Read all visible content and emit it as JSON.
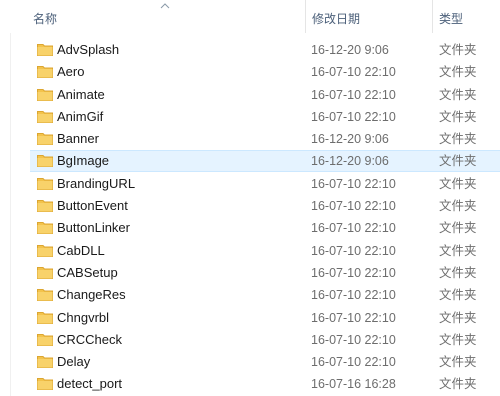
{
  "columns": {
    "name": "名称",
    "date": "修改日期",
    "type": "类型"
  },
  "accent": {
    "folder": "#f3c34c",
    "folder_dark": "#dca631",
    "selection": "#e5f3ff"
  },
  "files": [
    {
      "name": "AdvSplash",
      "date": "16-12-20 9:06",
      "type": "文件夹"
    },
    {
      "name": "Aero",
      "date": "16-07-10 22:10",
      "type": "文件夹"
    },
    {
      "name": "Animate",
      "date": "16-07-10 22:10",
      "type": "文件夹"
    },
    {
      "name": "AnimGif",
      "date": "16-07-10 22:10",
      "type": "文件夹"
    },
    {
      "name": "Banner",
      "date": "16-12-20 9:06",
      "type": "文件夹"
    },
    {
      "name": "BgImage",
      "date": "16-12-20 9:06",
      "type": "文件夹"
    },
    {
      "name": "BrandingURL",
      "date": "16-07-10 22:10",
      "type": "文件夹"
    },
    {
      "name": "ButtonEvent",
      "date": "16-07-10 22:10",
      "type": "文件夹"
    },
    {
      "name": "ButtonLinker",
      "date": "16-07-10 22:10",
      "type": "文件夹"
    },
    {
      "name": "CabDLL",
      "date": "16-07-10 22:10",
      "type": "文件夹"
    },
    {
      "name": "CABSetup",
      "date": "16-07-10 22:10",
      "type": "文件夹"
    },
    {
      "name": "ChangeRes",
      "date": "16-07-10 22:10",
      "type": "文件夹"
    },
    {
      "name": "Chngvrbl",
      "date": "16-07-10 22:10",
      "type": "文件夹"
    },
    {
      "name": "CRCCheck",
      "date": "16-07-10 22:10",
      "type": "文件夹"
    },
    {
      "name": "Delay",
      "date": "16-07-10 22:10",
      "type": "文件夹"
    },
    {
      "name": "detect_port",
      "date": "16-07-16 16:28",
      "type": "文件夹"
    }
  ]
}
